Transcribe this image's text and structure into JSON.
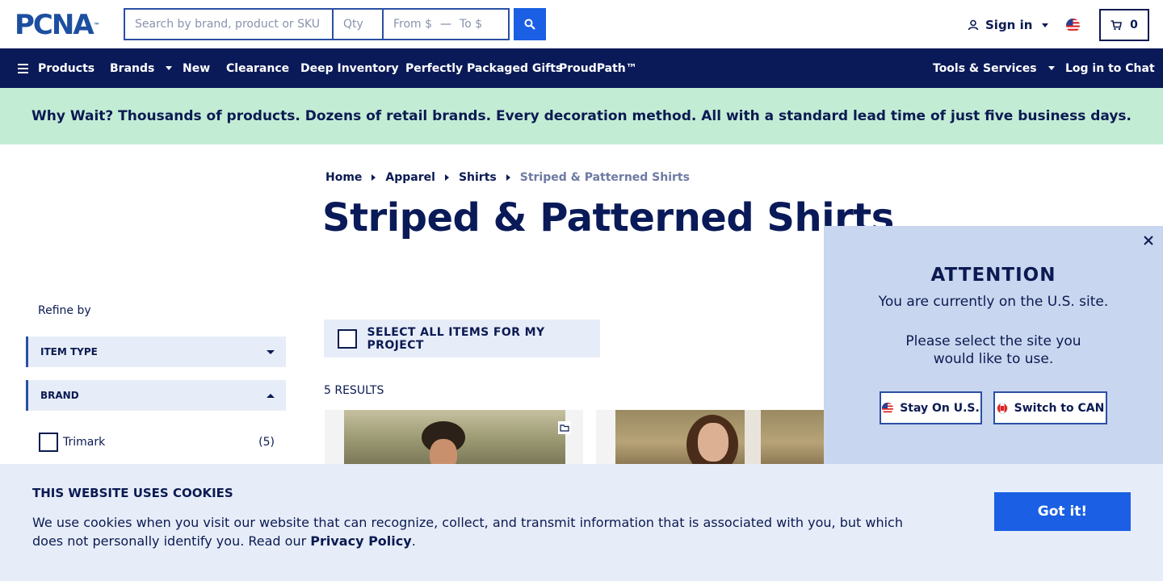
{
  "header": {
    "logo_text": "PCNA",
    "logo_mark": "™",
    "search_placeholder": "Search by brand, product or SKU",
    "qty_placeholder": "Qty",
    "price_from_placeholder": "From $",
    "price_to_placeholder": "To $",
    "sign_in_label": "Sign in",
    "cart_count": "0",
    "accent_color": "#1a5fe4"
  },
  "nav": {
    "products_label": "Products",
    "brands_label": "Brands",
    "new_label": "New",
    "clearance_label": "Clearance",
    "deep_inventory_label": "Deep Inventory",
    "gifts_label": "Perfectly Packaged Gifts",
    "proudpath_label": "ProudPath™",
    "tools_label": "Tools & Services",
    "chat_label": "Log in to Chat",
    "bg_color": "#0a1a58"
  },
  "promo": {
    "text": "Why Wait? Thousands of products. Dozens of retail brands. Every decoration method. All with a standard lead time of just five business days.",
    "bg_color": "#c3ecd5"
  },
  "breadcrumb": {
    "items": [
      "Home",
      "Apparel",
      "Shirts",
      "Striped & Patterned Shirts"
    ]
  },
  "page": {
    "title": "Striped & Patterned Shirts"
  },
  "sidebar": {
    "refine_label": "Refine by",
    "facets": [
      {
        "label": "ITEM TYPE",
        "state": "collapsed"
      },
      {
        "label": "BRAND",
        "state": "expanded"
      }
    ],
    "brand_options": [
      {
        "label": "Trimark",
        "count": "(5)"
      }
    ]
  },
  "main": {
    "select_all_label": "SELECT ALL ITEMS FOR MY PROJECT",
    "results_label": "5 RESULTS"
  },
  "attention_modal": {
    "title": "ATTENTION",
    "line1": "You are currently on the U.S. site.",
    "line2": "Please select the site you would like to use.",
    "stay_label": "Stay On U.S.",
    "switch_label": "Switch to CAN",
    "bg_color": "#c9d6ef"
  },
  "cookie_banner": {
    "title": "THIS WEBSITE USES COOKIES",
    "text": "We use cookies when you visit our website that can recognize, collect, and transmit information that is associated with you, but which does not personally identify you. Read our ",
    "policy_link": "Privacy Policy",
    "text_end": ".",
    "button_label": "Got it!"
  }
}
